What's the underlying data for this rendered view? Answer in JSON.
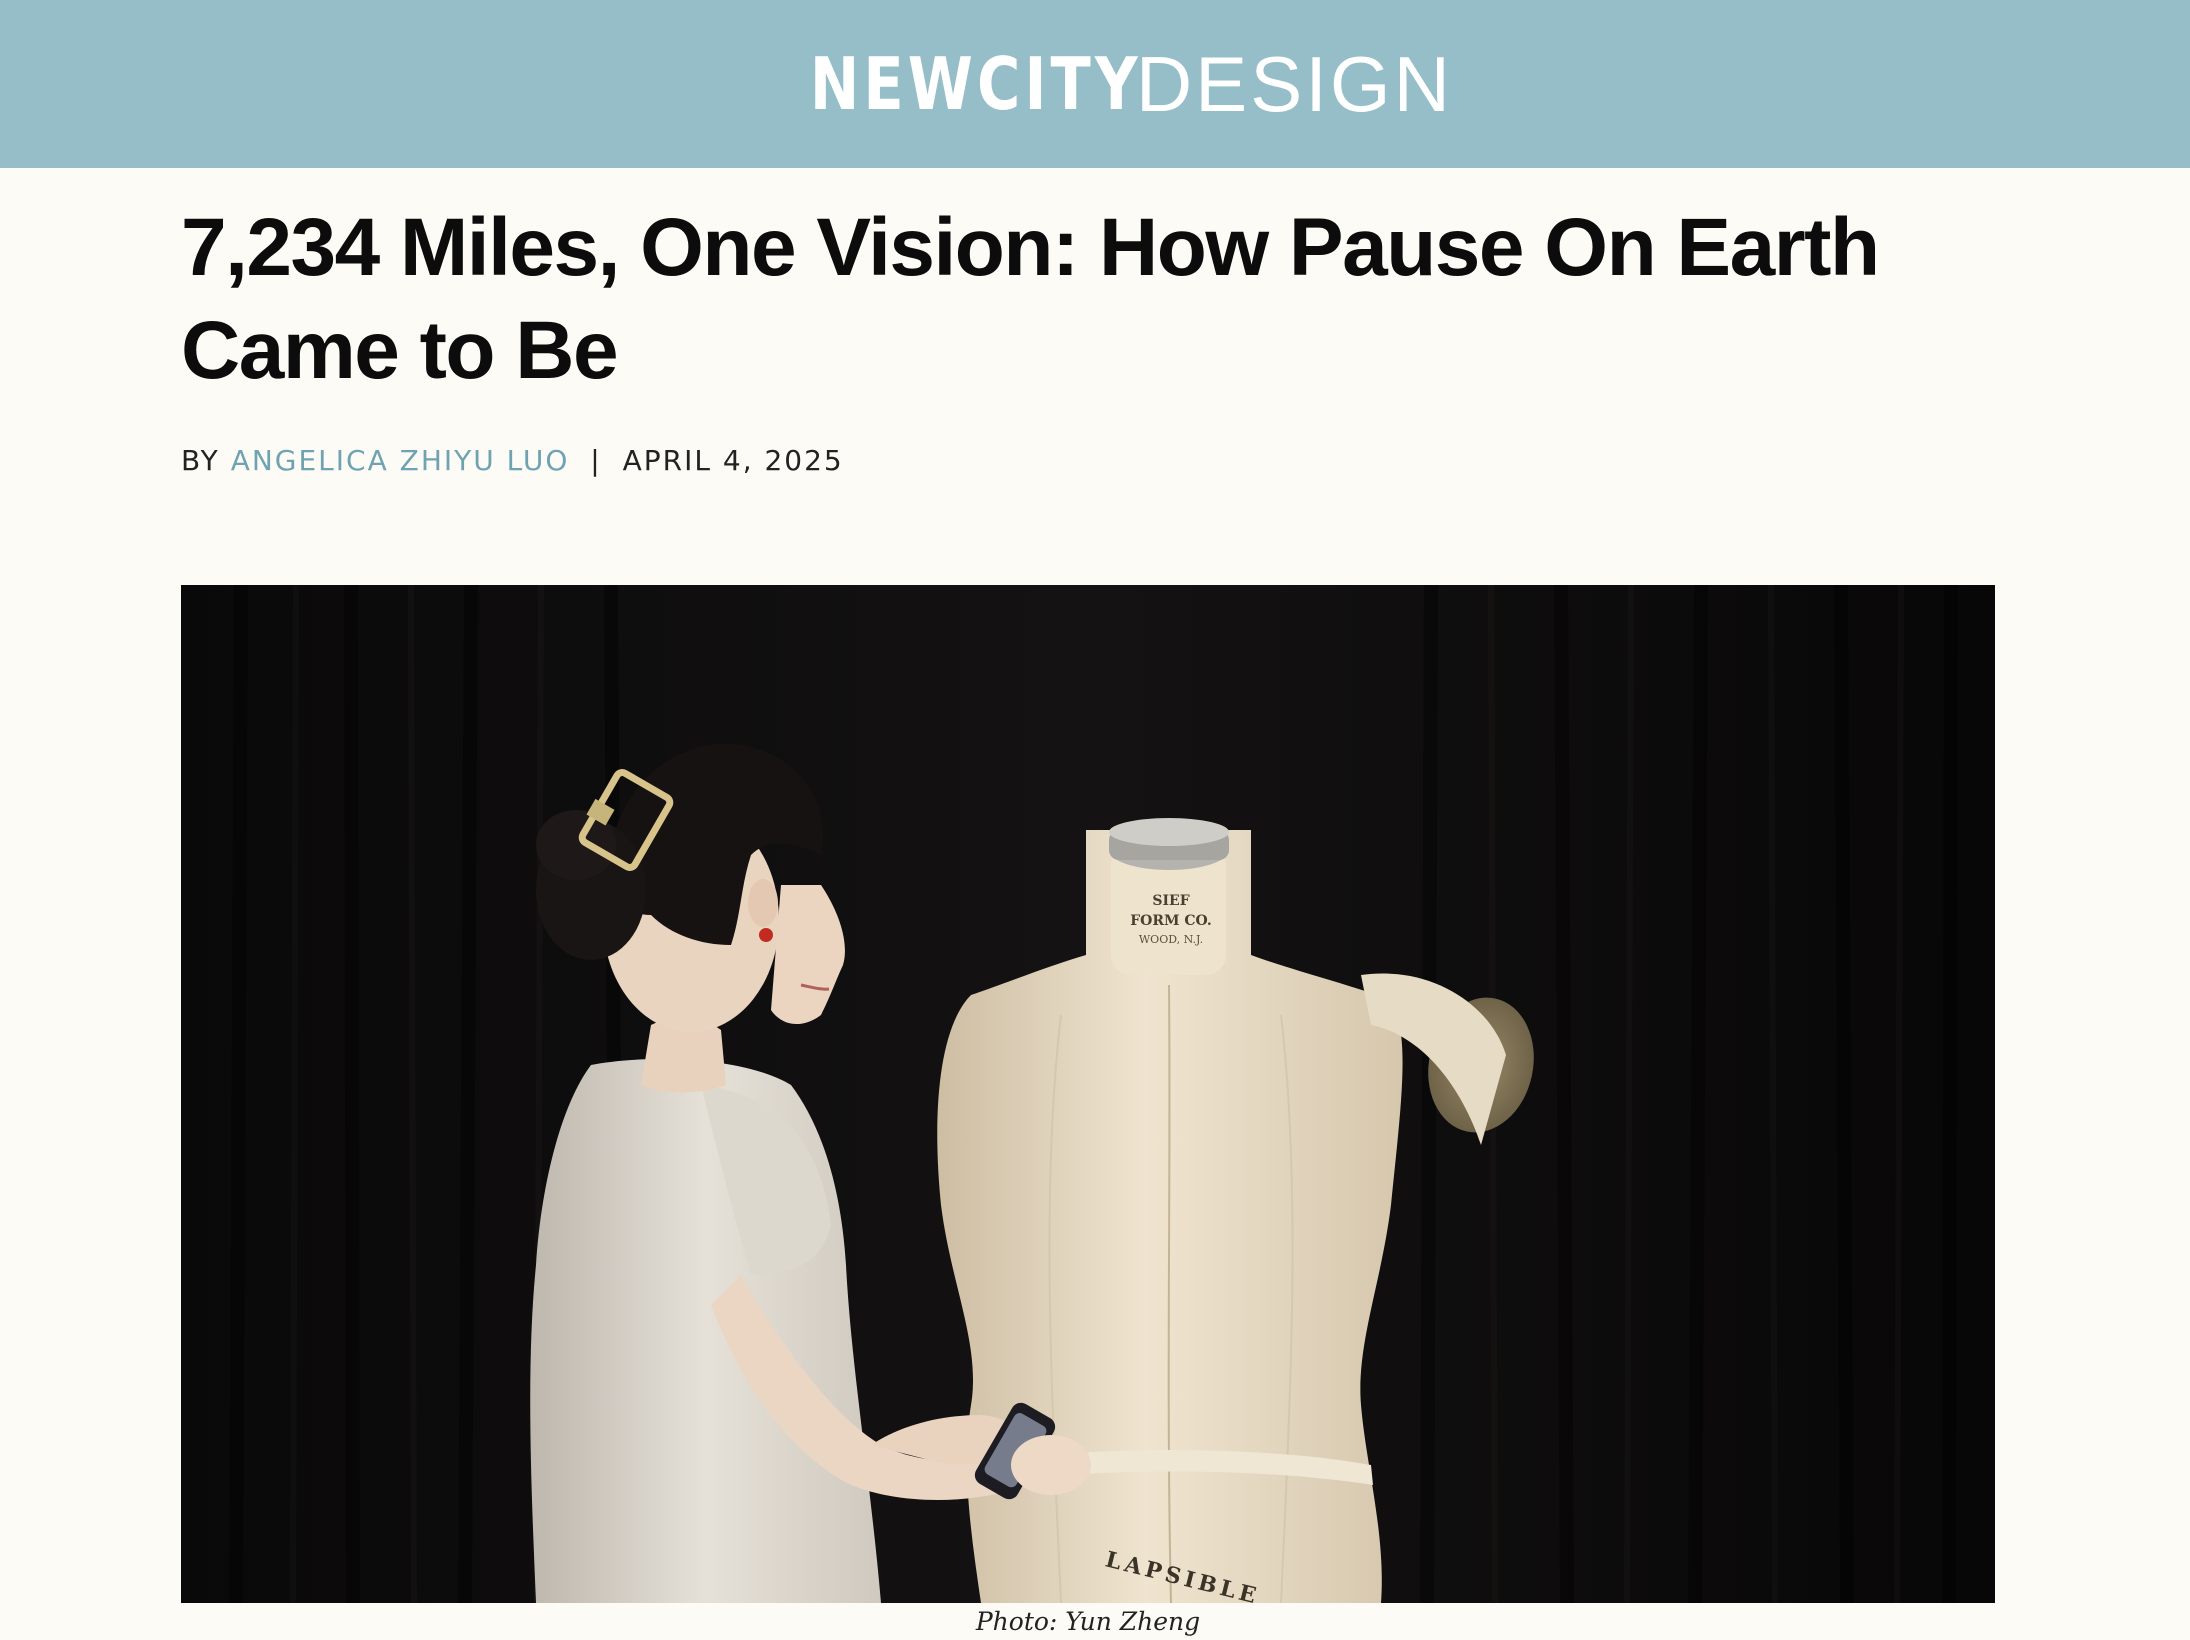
{
  "header": {
    "logo_bold": "NEWCITY",
    "logo_light": "DESIGN",
    "background_color": "#95bec8"
  },
  "article": {
    "title": "7,234 Miles, One Vision: How Pause On Earth Came to Be",
    "byline_prefix": "BY",
    "author": "ANGELICA ZHIYU LUO",
    "separator": "|",
    "date": "APRIL 4, 2025",
    "author_color": "#6fa3b2"
  },
  "photo": {
    "dress_form_label": [
      "SIEF",
      "FORM CO.",
      "WOOD, N.J."
    ],
    "dress_form_band_text": "LAPSIBLE"
  },
  "caption": "Photo: Yun Zheng"
}
